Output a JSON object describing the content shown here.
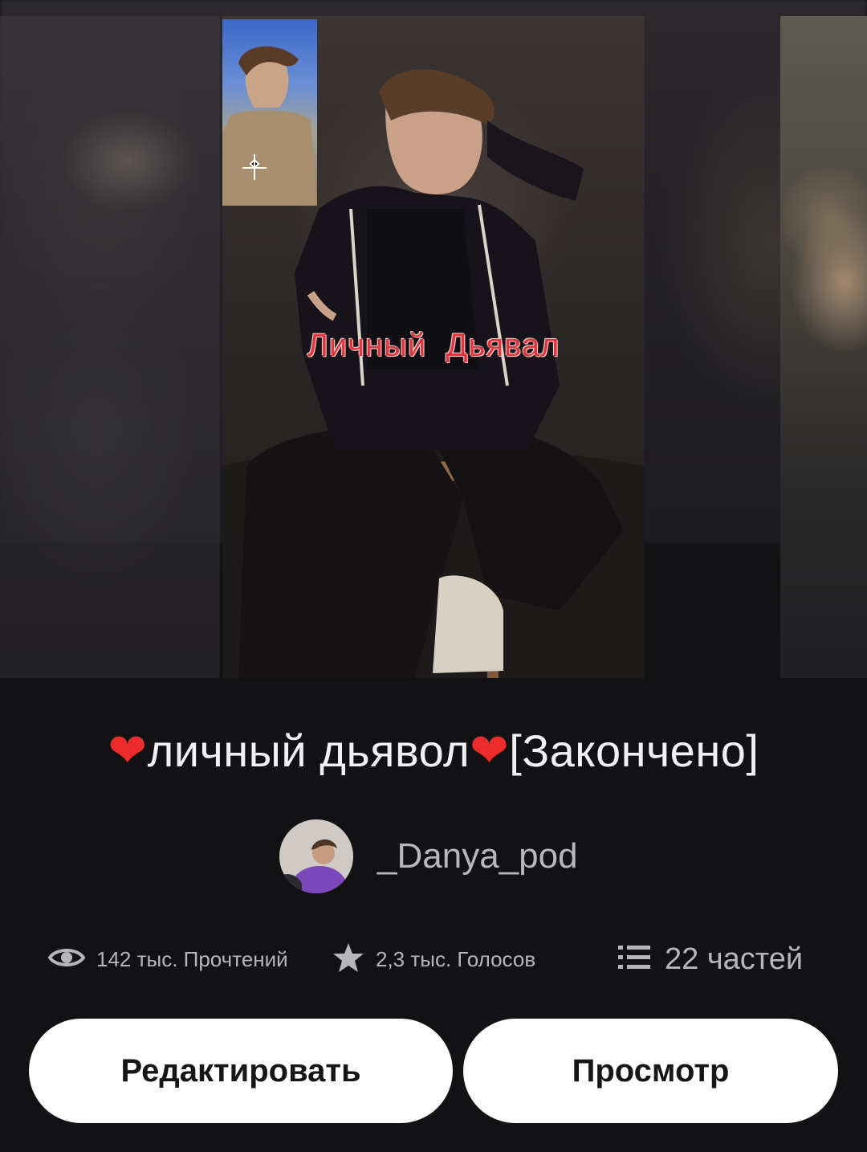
{
  "cover": {
    "overlay_text": "Личный  Дьявал"
  },
  "story": {
    "heart_left": "❤",
    "title": "личный дьявол",
    "heart_right": "❤",
    "status": "[Закончено]"
  },
  "author": {
    "name": "_Danya_pod"
  },
  "stats": {
    "reads_label": "142 тыс. Прочтений",
    "votes_label": "2,3 тыс. Голосов",
    "parts_label": "22 частей",
    "reads_icon": "eye-icon",
    "votes_icon": "star-icon",
    "parts_icon": "list-icon"
  },
  "actions": {
    "edit_label": "Редактировать",
    "view_label": "Просмотр"
  },
  "colors": {
    "background": "#121114",
    "button_bg": "#ffffff",
    "heart": "#ee2b2b",
    "cover_title": "#e2343a"
  }
}
